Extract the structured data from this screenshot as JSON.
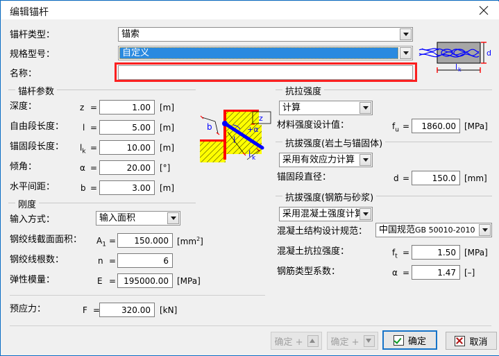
{
  "window": {
    "title": "编辑锚杆",
    "close_icon": "close-icon"
  },
  "top_fields": {
    "anchor_type_label": "锚杆类型：",
    "anchor_type_value": "锚索",
    "spec_model_label": "规格型号：",
    "spec_model_value": "自定义",
    "name_label": "名称：",
    "name_value": ""
  },
  "groups": {
    "anchor_params": "锚杆参数",
    "stiffness": "刚度",
    "tensile_strength": "抗拉强度",
    "pullout_soil": "抗拔强度(岩土与锚固体)",
    "pullout_rebar": "抗拔强度(钢筋与砂浆)"
  },
  "anchor_params": [
    {
      "label": "深度：",
      "sym": "z",
      "sub": "",
      "eq": "=",
      "value": "1.00",
      "unit": "[m]"
    },
    {
      "label": "自由段长度：",
      "sym": "l",
      "sub": "",
      "eq": "=",
      "value": "5.00",
      "unit": "[m]"
    },
    {
      "label": "锚固段长度：",
      "sym": "l",
      "sub": "k",
      "eq": "=",
      "value": "10.00",
      "unit": "[m]"
    },
    {
      "label": "倾角：",
      "sym": "α",
      "sub": "",
      "eq": "=",
      "value": "20.00",
      "unit": "[°]"
    },
    {
      "label": "水平间距：",
      "sym": "b",
      "sub": "",
      "eq": "=",
      "value": "3.00",
      "unit": "[m]"
    }
  ],
  "stiffness": {
    "input_mode_label": "输入方式：",
    "input_mode_value": "输入面积",
    "rows": [
      {
        "label": "钢绞线截面面积：",
        "sym": "A",
        "sub": "1",
        "eq": "=",
        "value": "150.000",
        "unit": "[mm",
        "unit_sup": "2",
        "unit_tail": "]"
      },
      {
        "label": "钢绞线根数：",
        "sym": "n",
        "sub": "",
        "eq": "=",
        "value": "6",
        "unit": "",
        "unit_sup": "",
        "unit_tail": ""
      },
      {
        "label": "弹性模量：",
        "sym": "E",
        "sub": "",
        "eq": "=",
        "value": "195000.00",
        "unit": "[MPa",
        "unit_sup": "",
        "unit_tail": "]"
      }
    ]
  },
  "prestress": {
    "label": "预应力：",
    "sym": "F",
    "eq": "=",
    "value": "320.00",
    "unit": "[kN]"
  },
  "tensile": {
    "method_value": "计算",
    "design_label": "材料强度设计值：",
    "design_sym": "f",
    "design_sub": "u",
    "design_eq": "=",
    "design_value": "1860.00",
    "design_unit": "[MPa]"
  },
  "pullout_soil": {
    "method_value": "采用有效应力计算",
    "diameter_label": "锚固段直径：",
    "diameter_sym": "d",
    "diameter_eq": "=",
    "diameter_value": "150.0",
    "diameter_unit": "[mm]"
  },
  "pullout_rebar": {
    "method_value": "采用混凝土强度计算",
    "code_label": "混凝土结构设计规范：",
    "code_value_cn": "中国规范",
    "code_value_en": "GB 50010-2010",
    "ft_label": "混凝土抗拉强度：",
    "ft_sym": "f",
    "ft_sub": "t",
    "ft_eq": "=",
    "ft_value": "1.50",
    "ft_unit": "[MPa]",
    "alpha_label": "钢筋类型系数：",
    "alpha_sym": "α",
    "alpha_eq": "=",
    "alpha_value": "1.47",
    "alpha_unit": "[–]"
  },
  "buttons": {
    "ok_prev": "确定 +",
    "ok_next": "确定 +",
    "ok": "确定",
    "cancel": "取消"
  },
  "diagrams": {
    "anchor_detail_labels": {
      "d": "d",
      "lk": "l"
    },
    "section_labels": {
      "b": "b",
      "z": "z",
      "alpha": "+α",
      "l": "l",
      "lk": "l"
    }
  },
  "colors": {
    "accent_blue": "#1673c8",
    "highlight_blue": "#2a8ae0",
    "annotation_red": "#fb2020",
    "hatch_yellow": "#ffff00",
    "diagram_red": "#ff0000",
    "diagram_blue": "#0000ff"
  }
}
